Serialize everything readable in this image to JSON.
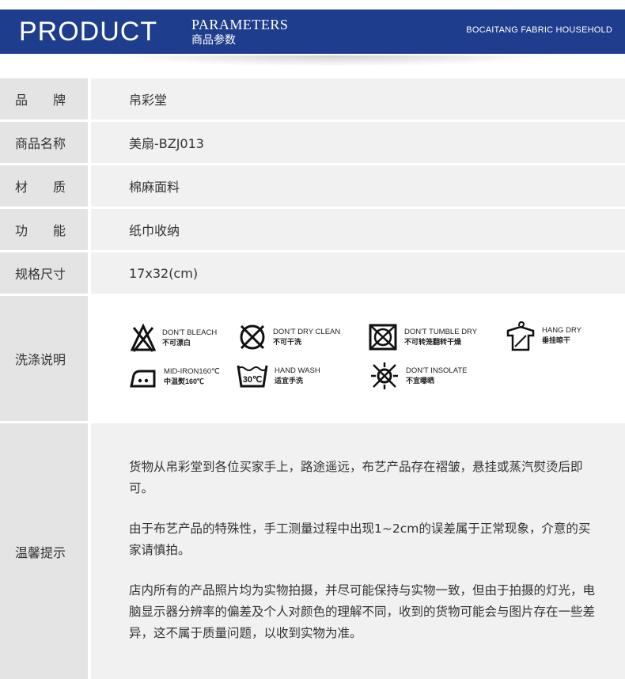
{
  "header": {
    "title": "PRODUCT",
    "subtitle_en": "PARAMETERS",
    "subtitle_cn": "商品参数",
    "brand": "BOCAITANG FABRIC HOUSEHOLD"
  },
  "params": [
    {
      "label": "品　　牌",
      "value": "帛彩堂"
    },
    {
      "label": "商品名称",
      "value": "美扇-BZJ013"
    },
    {
      "label": "材　　质",
      "value": "棉麻面料"
    },
    {
      "label": "功　　能",
      "value": "纸巾收纳"
    },
    {
      "label": "规格尺寸",
      "value": "17x32(cm)"
    }
  ],
  "care": {
    "label": "洗涤说明",
    "items": [
      {
        "icon": "no-bleach-icon",
        "en": "DON'T BLEACH",
        "cn": "不可漂白"
      },
      {
        "icon": "no-dry-clean-icon",
        "en": "DON'T DRY CLEAN",
        "cn": "不可干洗"
      },
      {
        "icon": "no-tumble-dry-icon",
        "en": "DON'T TUMBLE DRY",
        "cn": "不可转笼翻转干燥"
      },
      {
        "icon": "hang-dry-icon",
        "en": "HANG DRY",
        "cn": "垂挂晾干"
      },
      {
        "icon": "iron-icon",
        "en": "MID-IRON160℃",
        "cn": "中温熨160℃"
      },
      {
        "icon": "hand-wash-icon",
        "en": "HAND WASH",
        "cn": "适宜手洗",
        "icon_text": "30℃"
      },
      {
        "icon": "no-insolate-icon",
        "en": "DON'T INSOLATE",
        "cn": "不宜曝晒"
      }
    ]
  },
  "tips": {
    "label": "温馨提示",
    "paragraphs": [
      "货物从帛彩堂到各位买家手上，路途遥远，布艺产品存在褶皱，悬挂或蒸汽熨烫后即可。",
      "由于布艺产品的特殊性，手工测量过程中出现1~2cm的误差属于正常现象，介意的买家请慎拍。",
      "店内所有的产品照片均为实物拍摄，并尽可能保持与实物一致，但由于拍摄的灯光，电脑显示器分辨率的偏差及个人对颜色的理解不同，收到的货物可能会与图片存在一些差异，这不属于质量问题，以收到实物为准。"
    ]
  }
}
